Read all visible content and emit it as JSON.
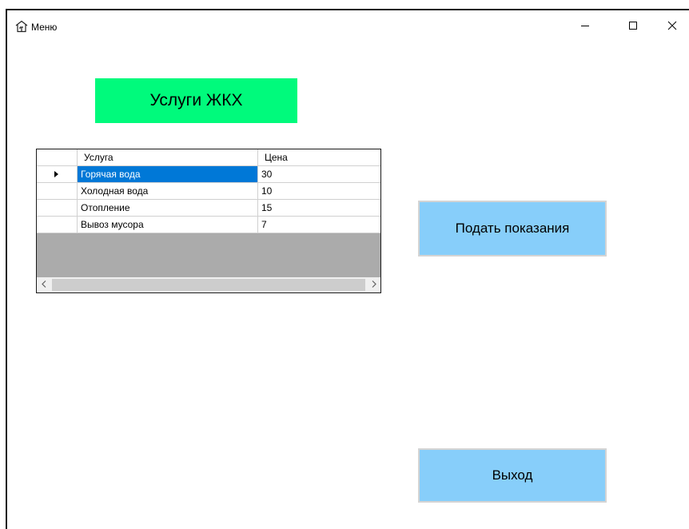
{
  "window": {
    "title": "Меню",
    "controls": {
      "minimize_icon": "minimize-icon",
      "maximize_icon": "maximize-icon",
      "close_icon": "close-icon"
    }
  },
  "banner": {
    "text": "Услуги ЖКХ",
    "color": "#00fa7c"
  },
  "grid": {
    "columns": [
      "Услуга",
      "Цена"
    ],
    "rows": [
      {
        "service": "Горячая вода",
        "price": "30",
        "selected": true
      },
      {
        "service": "Холодная вода",
        "price": "10",
        "selected": false
      },
      {
        "service": "Отопление",
        "price": "15",
        "selected": false
      },
      {
        "service": "Вывоз мусора",
        "price": "7",
        "selected": false
      }
    ],
    "selection_color": "#0078d7"
  },
  "buttons": {
    "submit_readings": "Подать показания",
    "exit": "Выход",
    "color": "#87cefa"
  }
}
